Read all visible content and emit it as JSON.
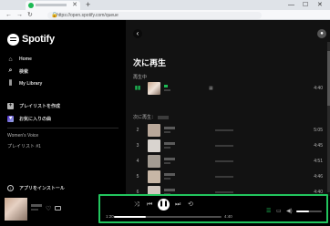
{
  "browser": {
    "new_tab_symbol": "+",
    "url": "https://open.spotify.com/queue",
    "window_controls": [
      "—",
      "☐",
      "✕"
    ]
  },
  "sidebar": {
    "brand": "Spotify",
    "nav": [
      {
        "label": "Home",
        "icon": "home-icon"
      },
      {
        "label": "検索",
        "icon": "search-icon"
      },
      {
        "label": "My Library",
        "icon": "library-icon"
      }
    ],
    "create_playlist": "プレイリストを作成",
    "liked_songs": "お気に入りの曲",
    "playlists": [
      "Women's Voice",
      "プレイリスト #1"
    ],
    "install_app": "アプリをインストール"
  },
  "queue": {
    "title": "次に再生",
    "now_playing_label": "再生中",
    "next_label": "次に再生：",
    "now_playing": {
      "index": "▮▮",
      "duration": "4:40"
    },
    "rows": [
      {
        "index": "2",
        "duration": "5:05",
        "thumb": "#b9a89a"
      },
      {
        "index": "3",
        "duration": "4:45",
        "thumb": "#d9d4cf"
      },
      {
        "index": "4",
        "duration": "4:51",
        "thumb": "#a39b92"
      },
      {
        "index": "5",
        "duration": "4:46",
        "thumb": "#c7b6a6"
      },
      {
        "index": "6",
        "duration": "4:40",
        "thumb": "#d0c6be"
      }
    ]
  },
  "player": {
    "elapsed": "1:20",
    "total": "4:40",
    "progress_fraction": 0.3,
    "volume_fraction": 0.5
  },
  "colors": {
    "accent": "#1db954",
    "highlight": "#22c55e"
  }
}
